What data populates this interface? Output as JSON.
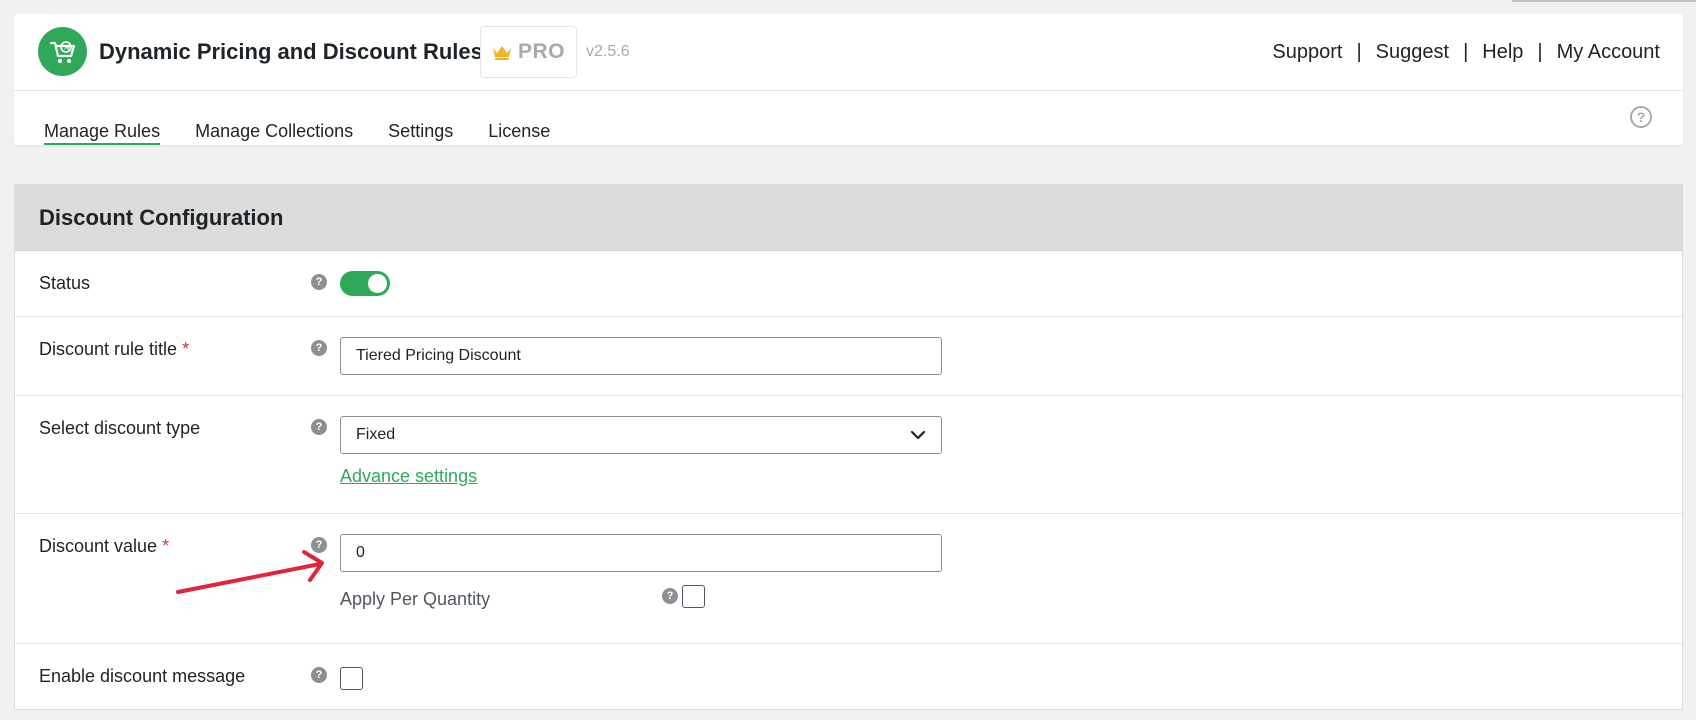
{
  "app": {
    "title": "Dynamic Pricing and Discount Rules",
    "pro_label": "PRO",
    "version": "v2.5.6"
  },
  "top_links": [
    "Support",
    "Suggest",
    "Help",
    "My Account"
  ],
  "link_separator": "|",
  "tabs": [
    {
      "label": "Manage Rules",
      "active": true
    },
    {
      "label": "Manage Collections",
      "active": false
    },
    {
      "label": "Settings",
      "active": false
    },
    {
      "label": "License",
      "active": false
    }
  ],
  "help_icon": "question-circle-icon",
  "panel": {
    "title": "Discount Configuration",
    "status": {
      "label": "Status",
      "enabled": true
    },
    "rule_title": {
      "label": "Discount rule title",
      "required_mark": "*",
      "value": "Tiered Pricing Discount"
    },
    "discount_type": {
      "label": "Select discount type",
      "value": "Fixed",
      "advance_link": "Advance settings"
    },
    "discount_value": {
      "label": "Discount value",
      "required_mark": "*",
      "value": "0",
      "apply_per_quantity_label": "Apply Per Quantity",
      "apply_per_quantity_checked": false
    },
    "discount_message": {
      "label": "Enable discount message",
      "checked": false
    },
    "help_mark": "?"
  },
  "colors": {
    "accent": "#2fa85a",
    "required": "#d63638",
    "annotation_arrow": "#e0243a",
    "panel_header_bg": "#dcdcdc"
  }
}
